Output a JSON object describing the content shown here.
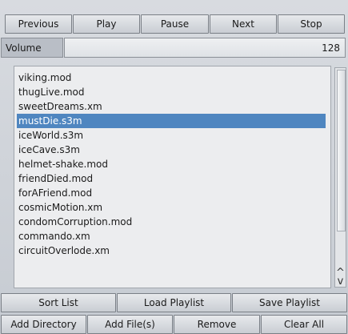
{
  "transport": {
    "previous": "Previous",
    "play": "Play",
    "pause": "Pause",
    "next": "Next",
    "stop": "Stop"
  },
  "volume": {
    "label": "Volume",
    "value": "128"
  },
  "playlist": {
    "items": [
      "viking.mod",
      "thugLive.mod",
      "sweetDreams.xm",
      "mustDie.s3m",
      "iceWorld.s3m",
      "iceCave.s3m",
      "helmet-shake.mod",
      "friendDied.mod",
      "forAFriend.mod",
      "cosmicMotion.xm",
      "condomCorruption.mod",
      "commando.xm",
      "circuitOverlode.xm"
    ],
    "selected_index": 3
  },
  "scrollbar": {
    "up_icon": "^",
    "down_icon": "v"
  },
  "actions_row1": {
    "sort": "Sort List",
    "load": "Load Playlist",
    "save": "Save Playlist"
  },
  "actions_row2": {
    "add_directory": "Add Directory",
    "add_files": "Add File(s)",
    "remove": "Remove",
    "clear": "Clear All"
  },
  "colors": {
    "selection": "#4f86c0",
    "background": "#c6cbd2"
  }
}
